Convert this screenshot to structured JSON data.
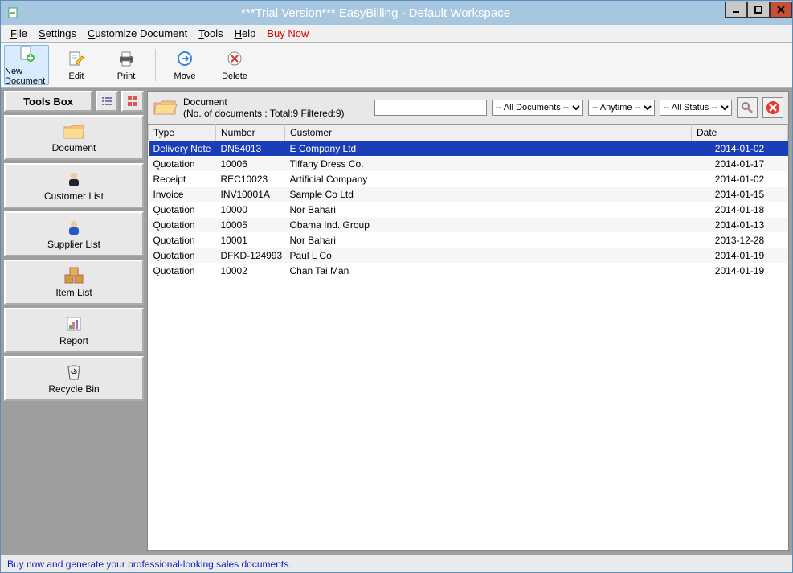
{
  "window": {
    "title": "***Trial Version*** EasyBilling - Default Workspace"
  },
  "menu": {
    "file": "File",
    "settings": "Settings",
    "customize": "Customize Document",
    "tools": "Tools",
    "help": "Help",
    "buy": "Buy Now"
  },
  "toolbar": {
    "new": "New Document",
    "edit": "Edit",
    "print": "Print",
    "move": "Move",
    "delete": "Delete"
  },
  "sidebar": {
    "toolsbox": "Tools Box",
    "items": {
      "document": "Document",
      "customer": "Customer List",
      "supplier": "Supplier List",
      "item": "Item List",
      "report": "Report",
      "recycle": "Recycle Bin"
    }
  },
  "filter": {
    "heading": "Document",
    "count": "(No. of documents : Total:9 Filtered:9)",
    "search_value": "",
    "all_docs": "-- All Documents --",
    "anytime": "-- Anytime --",
    "all_status": "-- All Status --"
  },
  "columns": {
    "type": "Type",
    "number": "Number",
    "customer": "Customer",
    "date": "Date"
  },
  "rows": [
    {
      "type": "Delivery Note",
      "number": "DN54013",
      "customer": "E Company Ltd",
      "date": "2014-01-02",
      "sel": true
    },
    {
      "type": "Quotation",
      "number": "10006",
      "customer": "Tiffany Dress Co.",
      "date": "2014-01-17"
    },
    {
      "type": "Receipt",
      "number": "REC10023",
      "customer": "Artificial Company",
      "date": "2014-01-02"
    },
    {
      "type": "Invoice",
      "number": "INV10001A",
      "customer": "Sample Co Ltd",
      "date": "2014-01-15"
    },
    {
      "type": "Quotation",
      "number": "10000",
      "customer": "Nor Bahari",
      "date": "2014-01-18"
    },
    {
      "type": "Quotation",
      "number": "10005",
      "customer": "Obama Ind. Group",
      "date": "2014-01-13"
    },
    {
      "type": "Quotation",
      "number": "10001",
      "customer": "Nor Bahari",
      "date": "2013-12-28"
    },
    {
      "type": "Quotation",
      "number": "DFKD-124993",
      "customer": "Paul L Co",
      "date": "2014-01-19"
    },
    {
      "type": "Quotation",
      "number": "10002",
      "customer": "Chan Tai Man",
      "date": "2014-01-19"
    }
  ],
  "status": {
    "text": "Buy now and generate your professional-looking sales documents."
  }
}
